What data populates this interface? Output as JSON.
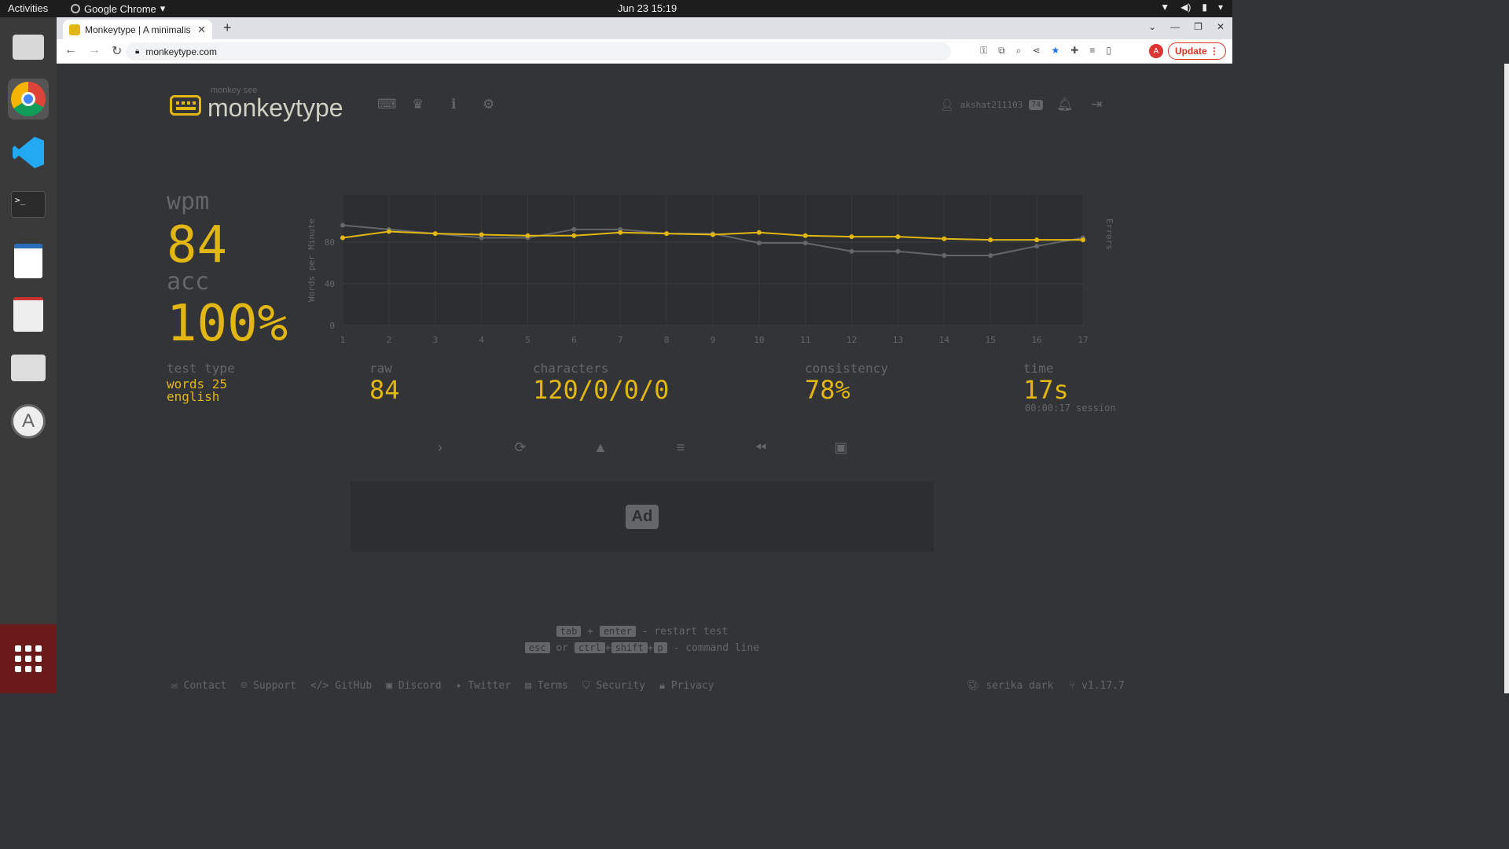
{
  "system": {
    "activities": "Activities",
    "app_name": "Google Chrome",
    "clock": "Jun 23  15:19"
  },
  "browser": {
    "tab_title": "Monkeytype | A minimalis",
    "url": "monkeytype.com",
    "update_label": "Update",
    "avatar_letter": "A"
  },
  "header": {
    "tagline": "monkey see",
    "brand": "monkeytype",
    "username": "akshat211103",
    "level": "74"
  },
  "result": {
    "wpm_label": "wpm",
    "wpm": "84",
    "acc_label": "acc",
    "acc": "100%",
    "test_type_label": "test type",
    "test_type_line1": "words 25",
    "test_type_line2": "english",
    "raw_label": "raw",
    "raw": "84",
    "characters_label": "characters",
    "characters": "120/0/0/0",
    "consistency_label": "consistency",
    "consistency": "78%",
    "time_label": "time",
    "time": "17s",
    "session": "00:00:17 session"
  },
  "ad": {
    "label": "Ad"
  },
  "hints": {
    "tab": "tab",
    "plus": "+",
    "enter": "enter",
    "restart": "- restart test",
    "esc": "esc",
    "or": "or",
    "ctrl": "ctrl",
    "shift": "shift",
    "p": "p",
    "command": "- command line"
  },
  "footer": {
    "links": [
      "Contact",
      "Support",
      "GitHub",
      "Discord",
      "Twitter",
      "Terms",
      "Security",
      "Privacy"
    ],
    "theme": "serika dark",
    "version": "v1.17.7"
  },
  "chart_data": {
    "type": "line",
    "x": [
      1,
      2,
      3,
      4,
      5,
      6,
      7,
      8,
      9,
      10,
      11,
      12,
      13,
      14,
      15,
      16,
      17
    ],
    "ylabel": "Words per Minute",
    "y2label": "Errors",
    "ylim": [
      0,
      125
    ],
    "yticks": [
      0,
      40,
      80
    ],
    "series": [
      {
        "name": "wpm",
        "color": "#e2b714",
        "values": [
          84,
          90,
          88,
          87,
          86,
          86,
          89,
          88,
          87,
          89,
          86,
          85,
          85,
          83,
          82,
          82,
          82
        ]
      },
      {
        "name": "raw",
        "color": "#646669",
        "values": [
          96,
          92,
          88,
          84,
          84,
          92,
          92,
          88,
          88,
          79,
          79,
          71,
          71,
          67,
          67,
          76,
          84
        ]
      }
    ]
  }
}
